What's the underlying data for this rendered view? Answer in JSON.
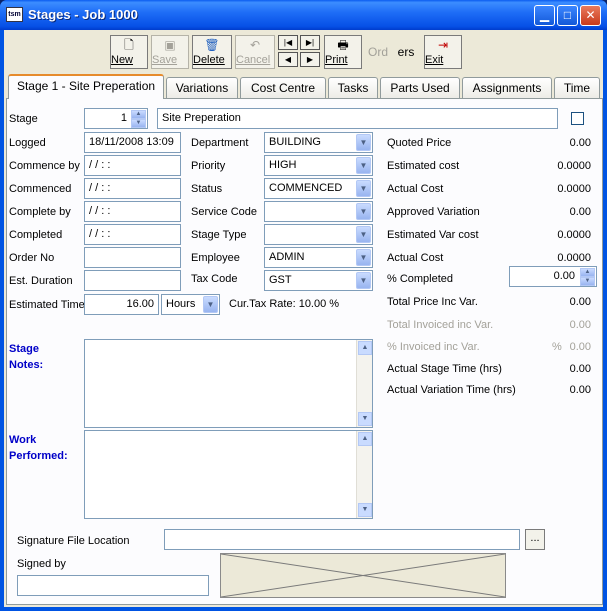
{
  "window": {
    "title": "Stages - Job 1000",
    "app_icon_text": "tsm",
    "buttons": {
      "minimize": "▁",
      "maximize": "□",
      "close": "✕"
    }
  },
  "toolbar": {
    "new": "New",
    "save": "Save",
    "delete": "Delete",
    "cancel": "Cancel",
    "print": "Print",
    "ord": "Ord",
    "ers": "ers",
    "exit": "Exit",
    "nav": {
      "first": "|◀",
      "last": "▶|",
      "prev": "◀",
      "next": "▶"
    }
  },
  "tabs": [
    "Stage 1 - Site Preperation",
    "Variations",
    "Cost Centre",
    "Tasks",
    "Parts Used",
    "Assignments",
    "Time"
  ],
  "form": {
    "stage_label": "Stage",
    "stage_number": "1",
    "stage_name": "Site Preperation",
    "logged_label": "Logged",
    "logged_value": "18/11/2008 13:09",
    "commence_by_label": "Commence by",
    "commence_by_value": " / /       :  :",
    "commenced_label": "Commenced",
    "commenced_value": " / /       :  :",
    "complete_by_label": "Complete by",
    "complete_by_value": " / /       :  :",
    "completed_label": "Completed",
    "completed_value": " / /       :  :",
    "order_no_label": "Order No",
    "order_no_value": "",
    "est_duration_label": "Est. Duration",
    "est_duration_value": "",
    "estimated_time_label": "Estimated Time",
    "estimated_time_value": "16.00",
    "time_unit": "Hours",
    "department_label": "Department",
    "department_value": "BUILDING",
    "priority_label": "Priority",
    "priority_value": "HIGH",
    "status_label": "Status",
    "status_value": "COMMENCED",
    "service_code_label": "Service Code",
    "service_code_value": "",
    "stage_type_label": "Stage Type",
    "stage_type_value": "",
    "employee_label": "Employee",
    "employee_value": "ADMIN",
    "tax_code_label": "Tax Code",
    "tax_code_value": "GST",
    "cur_tax_rate_text": "Cur.Tax Rate:  10.00 %",
    "stage_notes_label": "Stage\nNotes:",
    "work_performed_label": "Work\nPerformed:",
    "signature_label": "Signature File Location",
    "signature_value": "",
    "browse_label": "...",
    "signed_by_label": "Signed by",
    "signed_by_value": ""
  },
  "summary": {
    "quoted_price_label": "Quoted Price",
    "quoted_price": "0.00",
    "estimated_cost_label": "Estimated cost",
    "estimated_cost": "0.0000",
    "actual_cost_label": "Actual Cost",
    "actual_cost": "0.0000",
    "approved_variation_label": "Approved Variation",
    "approved_variation": "0.00",
    "estimated_var_cost_label": "Estimated Var cost",
    "estimated_var_cost": "0.0000",
    "actual_cost2_label": "Actual Cost",
    "actual_cost2": "0.0000",
    "pct_completed_label": "% Completed",
    "pct_completed": "0.00",
    "total_price_label": "Total Price Inc Var.",
    "total_price": "0.00",
    "total_invoiced_label": "Total Invoiced inc Var.",
    "total_invoiced": "0.00",
    "pct_invoiced_label": "% Invoiced inc Var.",
    "pct_invoiced_unit": "%",
    "pct_invoiced": "0.00",
    "actual_stage_time_label": "Actual Stage Time (hrs)",
    "actual_stage_time": "0.00",
    "actual_var_time_label": "Actual Variation Time (hrs)",
    "actual_var_time": "0.00"
  }
}
